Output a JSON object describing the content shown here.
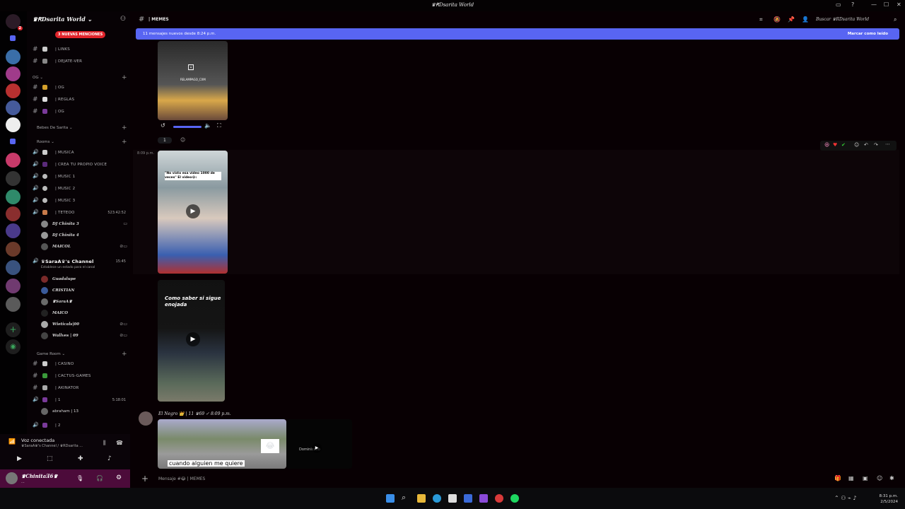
{
  "window": {
    "title": "♛ꞦDsarita World"
  },
  "guild": {
    "name": "♛ꞦDsarita World ⌄",
    "mentions_pill": "3 NUEVAS MENCIONES"
  },
  "channels": [
    {
      "name": "| LINKS"
    },
    {
      "name": "| DEJATE-VER"
    },
    {
      "name": "| OG"
    },
    {
      "name": "| REGLAS"
    },
    {
      "name": "| OG"
    },
    {
      "name": "| MUSICA"
    },
    {
      "name": "| CREA TU PROPIO VOICE"
    },
    {
      "name": "| MUSIC 1"
    },
    {
      "name": "| MUSIC 2"
    },
    {
      "name": "| MUSIC 3"
    },
    {
      "name": "| TETEOO",
      "extra": "523:42:52"
    },
    {
      "name": "| CASINO"
    },
    {
      "name": "| CACTUS-GAMES"
    },
    {
      "name": "| AKINATOR"
    },
    {
      "name": "| 1",
      "extra": "5:18:01"
    },
    {
      "name": "| 2"
    }
  ],
  "categories": {
    "og": "OG ⌄",
    "bebes": "Bebes De Sarita ⌄",
    "rooms": "Rooms ⌄",
    "game": "Game Room ⌄"
  },
  "voice_users_teteo": [
    "DJ Chinita 3",
    "DJ Chinita 4",
    "MAICOL"
  ],
  "channel_sarah": {
    "name": "♛SaraA♛'s Channel",
    "time": "15:45",
    "status": "Establece un estado para el canal"
  },
  "voice_users_sarah": [
    "Guadalupe",
    "CRISTIAN",
    "♛SaraA♛",
    "MAICO",
    "Wieticals|00",
    "Wallves | 09"
  ],
  "voice_users_game": [
    "abraham | 13"
  ],
  "voice": {
    "status": "Voz conectada",
    "sub": "♛SaraA♛'s Channel / ♛RDsarita ..."
  },
  "me": {
    "name": "♛ChinitaƎ6♛",
    "sub": "..."
  },
  "header": {
    "channel": "| MEMES",
    "search": "Buscar ♛RDsarita World"
  },
  "new_bar": {
    "text": "11 mensajes nuevos desde 8:24 p.m.",
    "action": "Marcar como leído"
  },
  "messages": {
    "time1": "8:09 p.m.",
    "author": "El Negro 👑 | 11 ♛69 ✓ 8:09 p.m.",
    "video1_caption": "\"No visto esa video 1000 de veces\"  El video😂:",
    "video2_caption": "Como saber si sigue enojada",
    "video3_caption": "cuando alguien me quiere",
    "video3_side": "Dominicano",
    "insta_handle": "RELAMPAGO_CXM",
    "reaction_count": "1"
  },
  "composer": {
    "placeholder": "Mensaje #😂 | MEMES"
  },
  "clock": {
    "time": "8:31 p.m.",
    "date": "2/5/2024"
  },
  "colors": {
    "accent": "#5865f2",
    "danger": "#e0242b",
    "user_panel": "#4c0b3a"
  }
}
